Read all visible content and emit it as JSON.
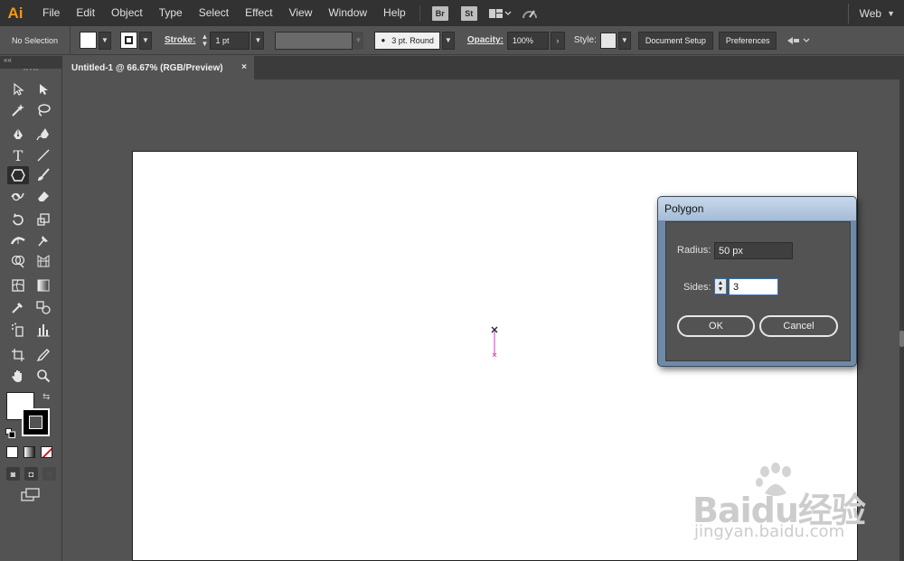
{
  "menubar": {
    "logo": "Ai",
    "items": [
      "File",
      "Edit",
      "Object",
      "Type",
      "Select",
      "Effect",
      "View",
      "Window",
      "Help"
    ],
    "badges": [
      "Br",
      "St"
    ],
    "workspace": "Web"
  },
  "controlbar": {
    "selection": "No Selection",
    "stroke_label": "Stroke:",
    "stroke_weight": "1 pt",
    "brush": "3 pt. Round",
    "opacity_label": "Opacity:",
    "opacity_value": "100%",
    "style_label": "Style:",
    "document_setup": "Document Setup",
    "preferences": "Preferences"
  },
  "tab": {
    "title": "Untitled-1 @ 66.67% (RGB/Preview)",
    "close": "×"
  },
  "toolbar": {
    "collapse": "««",
    "active_tool": "polygon-tool"
  },
  "dialog": {
    "title": "Polygon",
    "radius_label": "Radius:",
    "radius_value": "50 px",
    "sides_label": "Sides:",
    "sides_value": "3",
    "ok": "OK",
    "cancel": "Cancel"
  },
  "watermark": {
    "brand": "Baidu经验",
    "url": "jingyan.baidu.com"
  },
  "colors": {
    "accent_logo": "#f7941d",
    "path_preview": "#e64fd6",
    "dialog_frame": "#6f8aa6"
  }
}
